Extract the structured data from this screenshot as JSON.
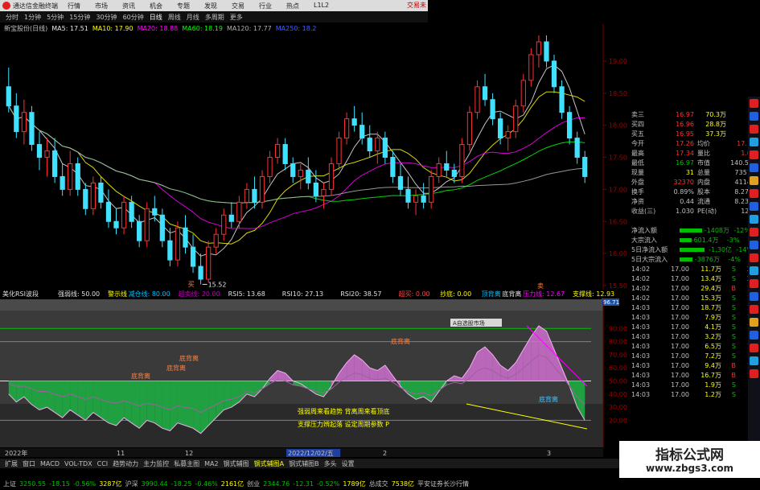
{
  "app": {
    "title": "通达信金融终端",
    "brand_label": "交易未",
    "menu": [
      "行情",
      "市场",
      "资讯",
      "机会",
      "专题",
      "发现",
      "交易",
      "行业",
      "热点",
      "L1L2"
    ]
  },
  "period_bar": {
    "items": [
      "分时",
      "1分钟",
      "5分钟",
      "15分钟",
      "30分钟",
      "60分钟",
      "日线",
      "周线",
      "月线",
      "多周期",
      "更多"
    ],
    "active_index": 6
  },
  "main_legend": {
    "stock": "新宝股份(日线)",
    "items": [
      {
        "label": "MA5: 17.51",
        "color": "#e8e8e8"
      },
      {
        "label": "MA10: 17.90",
        "color": "#ffff00"
      },
      {
        "label": "MA20: 18.88",
        "color": "#ff00ff"
      },
      {
        "label": "MA60: 18.19",
        "color": "#00ff00"
      },
      {
        "label": "MA120: 17.77",
        "color": "#b0b0b0"
      },
      {
        "label": "MA250: 18.2",
        "color": "#4060ff"
      }
    ]
  },
  "price_chart": {
    "y_ticks": [
      "19.00",
      "18.50",
      "18.00",
      "17.50",
      "17.00",
      "16.50",
      "16.00",
      "15.50"
    ],
    "low_marker": "15.52",
    "marker_buy": "买",
    "marker_sell": "卖"
  },
  "indicator": {
    "name": "美化RSI波段",
    "legend": [
      {
        "label": "强弱线: 50.00",
        "color": "#e0e0e0"
      },
      {
        "label": "警示线",
        "color": "#ffff00"
      },
      {
        "label": "减仓线: 80.00",
        "color": "#00c0ff"
      },
      {
        "label": "超卖线: 20.00",
        "color": "#c000c0"
      },
      {
        "label": "RSI5: 13.68",
        "color": "#e0e0e0"
      },
      {
        "label": "RSI10: 27.13",
        "color": "#e0e0e0"
      },
      {
        "label": "RSI20: 38.57",
        "color": "#e0e0e0"
      },
      {
        "label": "超买: 0.00",
        "color": "#ff4040"
      },
      {
        "label": "抄底: 0.00",
        "color": "#ffff00"
      },
      {
        "label": "顶背离",
        "color": "#00c0ff"
      },
      {
        "label": "底背离",
        "color": "#e0e0e0"
      },
      {
        "label": "压力线: 12.67",
        "color": "#ff00ff"
      },
      {
        "label": "支撑线: 12.93",
        "color": "#ffff00"
      }
    ],
    "level_badge": "96.71",
    "y_ticks": [
      "90.00",
      "80.00",
      "70.00",
      "60.00",
      "50.00",
      "40.00",
      "30.00",
      "20.00"
    ],
    "labels": [
      {
        "text": "底背离",
        "x": 163,
        "y": 470,
        "color": "#ff8040"
      },
      {
        "text": "底背离",
        "x": 223,
        "y": 448,
        "color": "#ff8040"
      },
      {
        "text": "底背离",
        "x": 207,
        "y": 460,
        "color": "#ff8040"
      },
      {
        "text": "底背离",
        "x": 486,
        "y": 427,
        "color": "#ff8040"
      },
      {
        "text": "底背离",
        "x": 670,
        "y": 499,
        "color": "#40c0ff"
      }
    ],
    "note_line1": "强弱周来看趋势 背离周来看顶底",
    "note_line2": "支撑压力辨起落 设定周期参数 P",
    "overlay_label": "A自选股市场"
  },
  "time_axis": {
    "labels": [
      "2022年",
      "11",
      "12",
      "2022/12/02/五",
      "2",
      "3"
    ],
    "highlight": "2022/12/02/五"
  },
  "quote_panel": {
    "book": [
      {
        "label": "卖三",
        "price": "16.97",
        "vol": "70.3万"
      },
      {
        "label": "买四",
        "price": "16.96",
        "vol": "28.8万"
      },
      {
        "label": "买五",
        "price": "16.95",
        "vol": "37.3万"
      }
    ],
    "stats": [
      {
        "l1": "今开",
        "v1": "17.26",
        "l2": "均价",
        "v2": "17.12"
      },
      {
        "l1": "最高",
        "v1": "17.34",
        "l2": "量比",
        "v2": "1.06"
      },
      {
        "l1": "最低",
        "v1": "16.97",
        "l2": "市值",
        "v2": "140.5亿"
      },
      {
        "l1": "现量",
        "v1": "31",
        "l2": "总量",
        "v2": "73511"
      },
      {
        "l1": "外盘",
        "v1": "32370",
        "l2": "内盘",
        "v2": "41141"
      },
      {
        "l1": "换手",
        "v1": "0.89%",
        "l2": "股本",
        "v2": "8.27亿"
      },
      {
        "l1": "净资",
        "v1": "0.44",
        "l2": "流通",
        "v2": "8.23亿"
      },
      {
        "l1": "收益(三)",
        "v1": "1.030",
        "l2": "PE(动)",
        "v2": "12.5"
      }
    ],
    "flows": [
      {
        "label": "净流入额",
        "value": "-1408万",
        "pct": "-12%"
      },
      {
        "label": "大宗流入",
        "value": "-601.4万",
        "pct": "-3%"
      },
      {
        "label": "5日净流入额",
        "value": "-1.30亿",
        "pct": "-14%"
      },
      {
        "label": "5日大宗流入",
        "value": "-3876万",
        "pct": "-4%"
      }
    ],
    "ticks": [
      {
        "time": "14:02",
        "price": "17.00",
        "vol": "11.7万",
        "bs": "S",
        "n": "25"
      },
      {
        "time": "14:02",
        "price": "17.00",
        "vol": "13.4万",
        "bs": "S",
        "n": "20"
      },
      {
        "time": "14:02",
        "price": "17.00",
        "vol": "29.4万",
        "bs": "B",
        "n": "16"
      },
      {
        "time": "14:02",
        "price": "17.00",
        "vol": "15.3万",
        "bs": "S",
        "n": "12"
      },
      {
        "time": "14:03",
        "price": "17.00",
        "vol": "18.7万",
        "bs": "S",
        "n": "19"
      },
      {
        "time": "14:03",
        "price": "17.00",
        "vol": "7.9万",
        "bs": "S",
        "n": "14"
      },
      {
        "time": "14:03",
        "price": "17.00",
        "vol": "4.1万",
        "bs": "S",
        "n": "10"
      },
      {
        "time": "14:03",
        "price": "17.00",
        "vol": "3.2万",
        "bs": "S",
        "n": "8"
      },
      {
        "time": "14:03",
        "price": "17.00",
        "vol": "6.5万",
        "bs": "S",
        "n": "12"
      },
      {
        "time": "14:03",
        "price": "17.00",
        "vol": "7.2万",
        "bs": "S",
        "n": "9"
      },
      {
        "time": "14:03",
        "price": "17.00",
        "vol": "9.4万",
        "bs": "B",
        "n": "15"
      },
      {
        "time": "14:03",
        "price": "17.00",
        "vol": "16.7万",
        "bs": "B",
        "n": "11"
      },
      {
        "time": "14:03",
        "price": "17.00",
        "vol": "1.9万",
        "bs": "S",
        "n": "5"
      },
      {
        "time": "14:03",
        "price": "17.00",
        "vol": "1.2万",
        "bs": "S",
        "n": "4"
      }
    ],
    "fenshi_label": "图文F10"
  },
  "bottom_tabs": {
    "items": [
      "扩展",
      "窗口",
      "MACD",
      "VOL-TDX",
      "CCI",
      "趋势动力",
      "主力监控",
      "私募主图",
      "MA2",
      "钢式辅图",
      "钢式辅图A",
      "钢式辅图B",
      "多头",
      "设置"
    ],
    "active_index": 10,
    "right_label": "模板"
  },
  "market_bar": [
    {
      "text": "上证",
      "color": "#c0c0c0"
    },
    {
      "text": "3250.55",
      "color": "#00c000"
    },
    {
      "text": "-18.15",
      "color": "#00c000"
    },
    {
      "text": "-0.56%",
      "color": "#00c000"
    },
    {
      "text": "3287亿",
      "color": "#ffff00"
    },
    {
      "text": "沪深",
      "color": "#c0c0c0"
    },
    {
      "text": "3990.44",
      "color": "#00c000"
    },
    {
      "text": "-18.25",
      "color": "#00c000"
    },
    {
      "text": "-0.46%",
      "color": "#00c000"
    },
    {
      "text": "2161亿",
      "color": "#ffff00"
    },
    {
      "text": "创业",
      "color": "#c0c0c0"
    },
    {
      "text": "2344.76",
      "color": "#00c000"
    },
    {
      "text": "-12.31",
      "color": "#00c000"
    },
    {
      "text": "-0.52%",
      "color": "#00c000"
    },
    {
      "text": "1789亿",
      "color": "#ffff00"
    },
    {
      "text": "总成交",
      "color": "#c0c0c0"
    },
    {
      "text": "7538亿",
      "color": "#ffff00"
    },
    {
      "text": "平安证券长沙行情",
      "color": "#c0c0c0"
    }
  ],
  "watermark": {
    "line1": "指标公式网",
    "line2": "www.zbgs3.com"
  },
  "colors": {
    "up": "#ff3030",
    "down": "#40e0ff",
    "rsi_up": "#d070d0",
    "rsi_down": "#20a040"
  },
  "chart_data": {
    "type": "candlestick",
    "series": [
      {
        "name": "K线",
        "ohlc": [
          [
            18.6,
            18.9,
            18.2,
            18.3
          ],
          [
            18.3,
            18.5,
            17.8,
            17.9
          ],
          [
            17.9,
            18.4,
            17.7,
            18.2
          ],
          [
            18.2,
            18.3,
            17.6,
            17.7
          ],
          [
            17.7,
            17.9,
            17.3,
            17.5
          ],
          [
            17.5,
            17.8,
            17.2,
            17.6
          ],
          [
            17.6,
            17.8,
            17.1,
            17.2
          ],
          [
            17.2,
            17.4,
            16.9,
            17.0
          ],
          [
            17.0,
            17.6,
            16.9,
            17.4
          ],
          [
            17.4,
            17.5,
            16.9,
            17.0
          ],
          [
            17.0,
            17.1,
            16.6,
            16.7
          ],
          [
            16.7,
            17.2,
            16.6,
            17.1
          ],
          [
            17.1,
            17.2,
            16.7,
            16.8
          ],
          [
            16.8,
            17.0,
            16.4,
            16.5
          ],
          [
            16.5,
            16.7,
            16.3,
            16.4
          ],
          [
            16.4,
            16.9,
            16.3,
            16.8
          ],
          [
            16.8,
            16.9,
            16.4,
            16.5
          ],
          [
            16.5,
            16.6,
            16.1,
            16.2
          ],
          [
            16.2,
            16.8,
            16.1,
            16.7
          ],
          [
            16.7,
            16.9,
            16.5,
            16.6
          ],
          [
            16.6,
            16.7,
            16.1,
            16.2
          ],
          [
            16.2,
            16.4,
            15.8,
            15.9
          ],
          [
            15.9,
            16.5,
            15.8,
            16.4
          ],
          [
            16.4,
            16.6,
            16.0,
            16.1
          ],
          [
            16.1,
            16.3,
            15.7,
            15.8
          ],
          [
            15.8,
            16.0,
            15.52,
            15.6
          ],
          [
            15.6,
            16.2,
            15.55,
            16.1
          ],
          [
            16.1,
            16.4,
            16.0,
            16.3
          ],
          [
            16.3,
            16.7,
            16.2,
            16.6
          ],
          [
            16.6,
            16.8,
            16.4,
            16.5
          ],
          [
            16.5,
            16.9,
            16.4,
            16.8
          ],
          [
            16.8,
            17.1,
            16.7,
            17.0
          ],
          [
            17.0,
            17.2,
            16.7,
            16.8
          ],
          [
            16.8,
            17.3,
            16.7,
            17.2
          ],
          [
            17.2,
            17.6,
            17.1,
            17.5
          ],
          [
            17.5,
            17.8,
            17.4,
            17.7
          ],
          [
            17.7,
            17.8,
            17.3,
            17.4
          ],
          [
            17.4,
            17.5,
            17.1,
            17.2
          ],
          [
            17.2,
            17.4,
            17.0,
            17.3
          ],
          [
            17.3,
            17.5,
            17.0,
            17.1
          ],
          [
            17.1,
            17.3,
            16.8,
            16.9
          ],
          [
            16.9,
            17.1,
            16.7,
            17.0
          ],
          [
            17.0,
            17.5,
            16.9,
            17.4
          ],
          [
            17.4,
            17.9,
            17.3,
            17.8
          ],
          [
            17.8,
            18.2,
            17.7,
            18.1
          ],
          [
            18.1,
            18.3,
            17.9,
            18.0
          ],
          [
            18.0,
            18.2,
            17.7,
            17.8
          ],
          [
            17.8,
            18.0,
            17.5,
            17.6
          ],
          [
            17.6,
            17.9,
            17.4,
            17.8
          ],
          [
            17.8,
            17.9,
            17.4,
            17.5
          ],
          [
            17.5,
            17.6,
            17.1,
            17.2
          ],
          [
            17.2,
            17.4,
            16.9,
            17.0
          ],
          [
            17.0,
            17.2,
            16.7,
            16.8
          ],
          [
            16.8,
            17.0,
            16.6,
            16.9
          ],
          [
            16.9,
            17.1,
            16.7,
            16.8
          ],
          [
            16.8,
            17.3,
            16.7,
            17.2
          ],
          [
            17.2,
            17.5,
            17.1,
            17.4
          ],
          [
            17.4,
            17.6,
            17.2,
            17.3
          ],
          [
            17.3,
            17.4,
            17.1,
            17.2
          ],
          [
            17.2,
            17.8,
            17.1,
            17.7
          ],
          [
            17.7,
            18.3,
            17.6,
            18.2
          ],
          [
            18.2,
            18.7,
            18.1,
            18.6
          ],
          [
            18.6,
            18.8,
            18.3,
            18.4
          ],
          [
            18.4,
            18.5,
            18.0,
            18.1
          ],
          [
            18.1,
            18.2,
            17.7,
            17.8
          ],
          [
            17.8,
            18.0,
            17.6,
            17.9
          ],
          [
            17.9,
            18.4,
            17.8,
            18.3
          ],
          [
            18.3,
            18.8,
            18.2,
            18.7
          ],
          [
            18.7,
            19.2,
            18.6,
            19.1
          ],
          [
            19.1,
            19.4,
            18.9,
            19.3
          ],
          [
            19.3,
            19.4,
            18.9,
            19.0
          ],
          [
            19.0,
            19.1,
            18.5,
            18.6
          ],
          [
            18.6,
            18.7,
            18.1,
            18.2
          ],
          [
            18.2,
            18.3,
            17.7,
            17.8
          ],
          [
            17.8,
            17.9,
            17.4,
            17.5
          ],
          [
            17.5,
            17.6,
            17.1,
            17.2
          ]
        ]
      }
    ],
    "indicator_series": [
      {
        "name": "RSI5",
        "values": [
          40,
          34,
          38,
          32,
          28,
          30,
          26,
          22,
          28,
          24,
          20,
          26,
          22,
          18,
          16,
          22,
          18,
          14,
          20,
          18,
          14,
          12,
          18,
          16,
          14,
          10,
          16,
          22,
          28,
          30,
          34,
          40,
          38,
          44,
          52,
          58,
          56,
          50,
          48,
          44,
          40,
          38,
          46,
          56,
          64,
          70,
          66,
          60,
          58,
          62,
          54,
          46,
          40,
          36,
          38,
          34,
          42,
          50,
          54,
          52,
          60,
          72,
          76,
          70,
          62,
          58,
          64,
          74,
          84,
          92,
          88,
          74,
          60,
          46,
          30,
          20
        ]
      },
      {
        "name": "RSI20",
        "values": [
          48,
          46,
          46,
          44,
          42,
          42,
          40,
          38,
          40,
          38,
          36,
          38,
          36,
          34,
          33,
          35,
          33,
          31,
          33,
          32,
          30,
          28,
          31,
          30,
          29,
          26,
          29,
          32,
          35,
          36,
          38,
          42,
          41,
          44,
          48,
          51,
          50,
          47,
          46,
          44,
          42,
          41,
          44,
          49,
          53,
          56,
          55,
          52,
          51,
          52,
          49,
          45,
          42,
          40,
          41,
          39,
          43,
          47,
          49,
          48,
          52,
          58,
          60,
          58,
          54,
          52,
          55,
          60,
          65,
          70,
          68,
          61,
          54,
          46,
          38,
          32
        ]
      }
    ],
    "ylim": [
      15.5,
      19.4
    ],
    "indicator_ylim": [
      0,
      100
    ],
    "grid": false,
    "legend": "top-left"
  }
}
